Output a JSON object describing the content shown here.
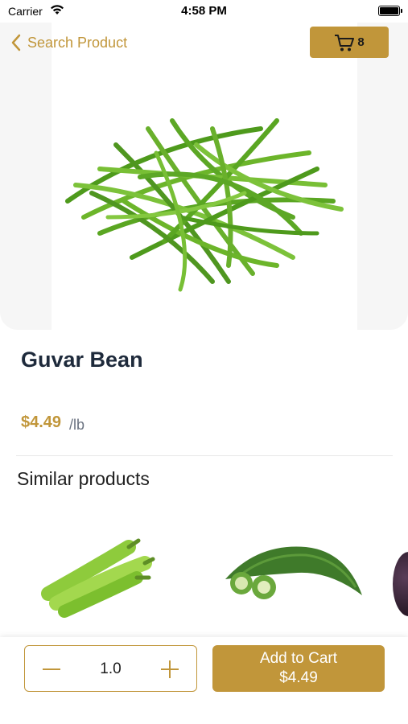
{
  "status": {
    "carrier": "Carrier",
    "time": "4:58 PM"
  },
  "nav": {
    "back_label": "Search Product",
    "cart_count": "8"
  },
  "product": {
    "name": "Guvar Bean",
    "price": "$4.49",
    "unit": "/lb"
  },
  "similar": {
    "title": "Similar products"
  },
  "bottom": {
    "quantity": "1.0",
    "add_label": "Add to Cart",
    "add_price": "$4.49"
  },
  "colors": {
    "accent": "#c1963a",
    "title": "#1e2a3b"
  }
}
